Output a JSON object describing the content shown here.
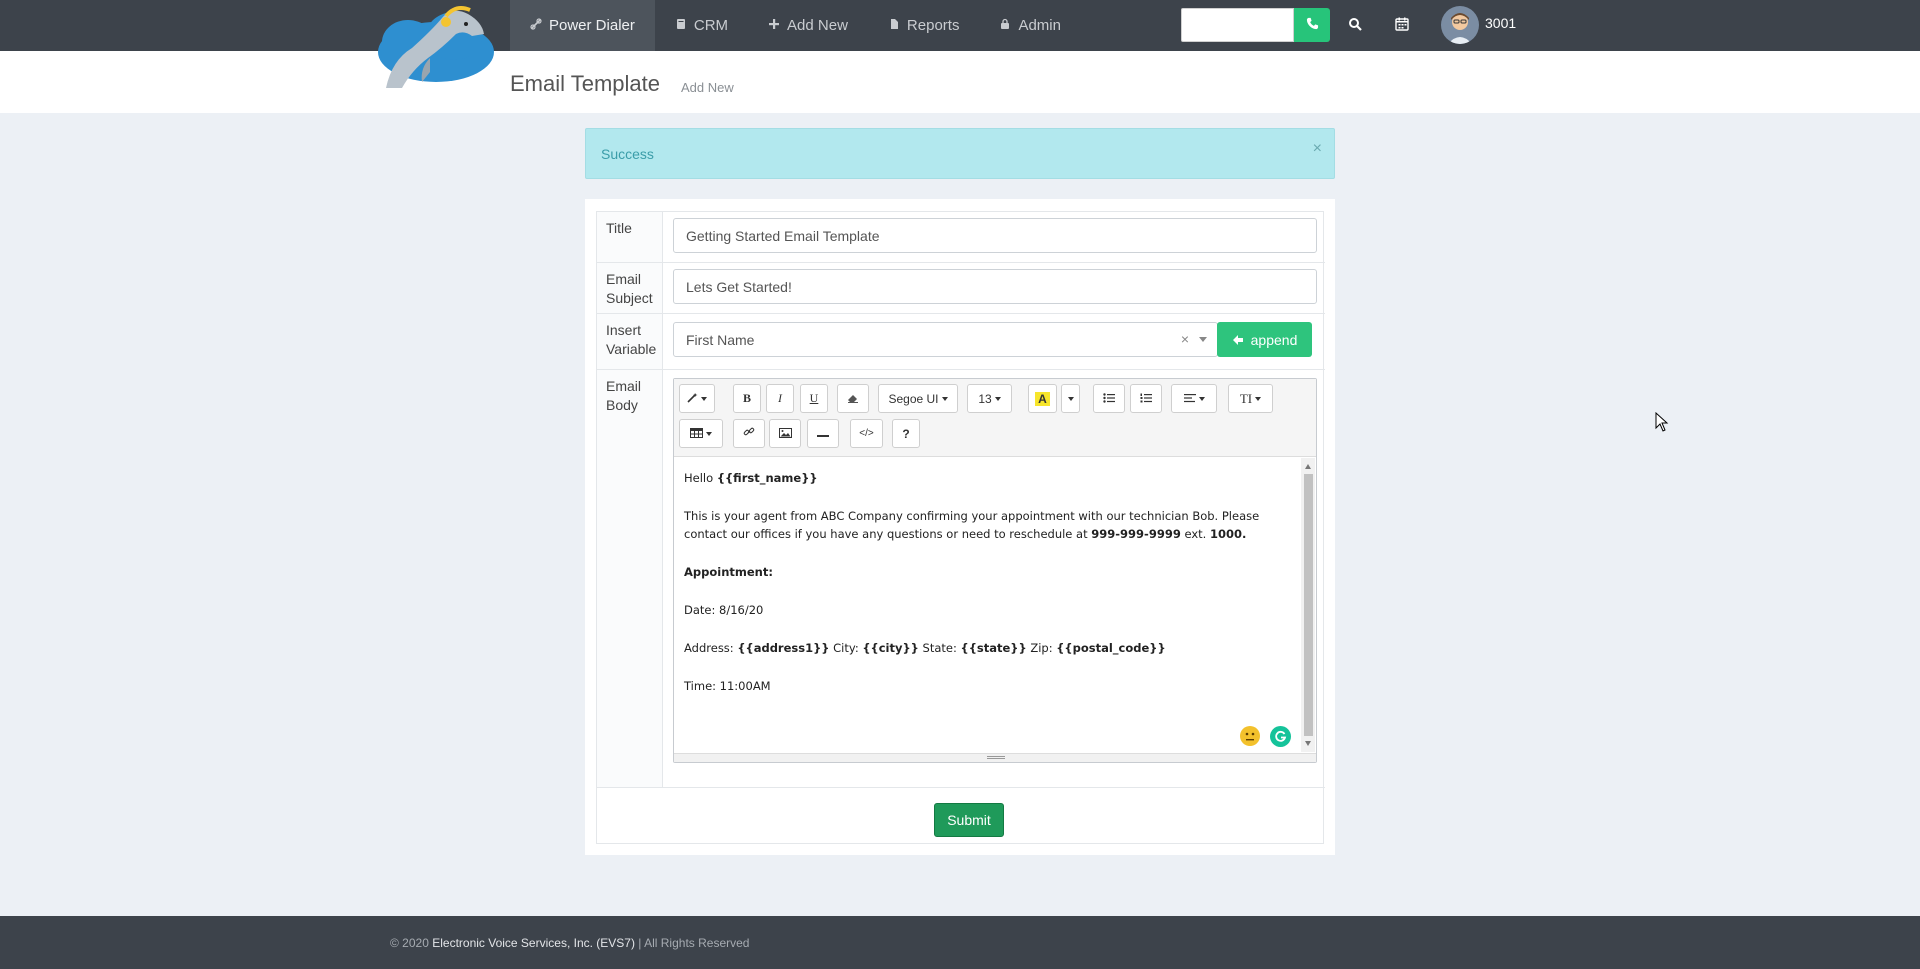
{
  "nav": {
    "items": [
      {
        "label": "Power Dialer",
        "icon": "link-icon",
        "active": true
      },
      {
        "label": "CRM",
        "icon": "book-icon",
        "active": false
      },
      {
        "label": "Add New",
        "icon": "plus-icon",
        "active": false
      },
      {
        "label": "Reports",
        "icon": "file-icon",
        "active": false
      },
      {
        "label": "Admin",
        "icon": "lock-icon",
        "active": false
      }
    ],
    "dial_input_value": "",
    "extension": "3001",
    "colors": {
      "bar": "#3d434b",
      "accent": "#27c47a"
    }
  },
  "header": {
    "title": "Email Template",
    "subtitle": "Add New"
  },
  "alert": {
    "text": "Success",
    "close": "×"
  },
  "form": {
    "title_label": "Title",
    "title_value": "Getting Started Email Template",
    "subject_label_1": "Email",
    "subject_label_2": "Subject",
    "subject_value": "Lets Get Started!",
    "variable_label_1": "Insert",
    "variable_label_2": "Variable",
    "variable_value": "First Name",
    "variable_clear": "×",
    "append_label": "append",
    "body_label_1": "Email",
    "body_label_2": "Body",
    "submit_label": "Submit"
  },
  "editor": {
    "font_name": "Segoe UI",
    "font_size": "13",
    "help": "?",
    "content": {
      "greeting": "Hello ",
      "greeting_var": "{{first_name}}",
      "p1_a": "This is your agent from ABC Company confirming your appointment with our technician Bob. Please contact our offices if you have any questions or need to reschedule at ",
      "p1_phone": "999-999-9999",
      "p1_ext": " ext. ",
      "p1_ext_num": "1000.",
      "appt": "Appointment:",
      "date": "Date: 8/16/20",
      "addr_label": "Address: ",
      "addr_var": "{{address1}}",
      "city_label": " City: ",
      "city_var": "{{city}}",
      "state_label": " State: ",
      "state_var": "{{state}}",
      "zip_label": " Zip: ",
      "zip_var": "{{postal_code}}",
      "time": "Time: 11:00AM"
    }
  },
  "footer": {
    "prefix": "© 2020 ",
    "company": "Electronic Voice Services, Inc. (EVS7)",
    "suffix": " | All Rights Reserved"
  }
}
